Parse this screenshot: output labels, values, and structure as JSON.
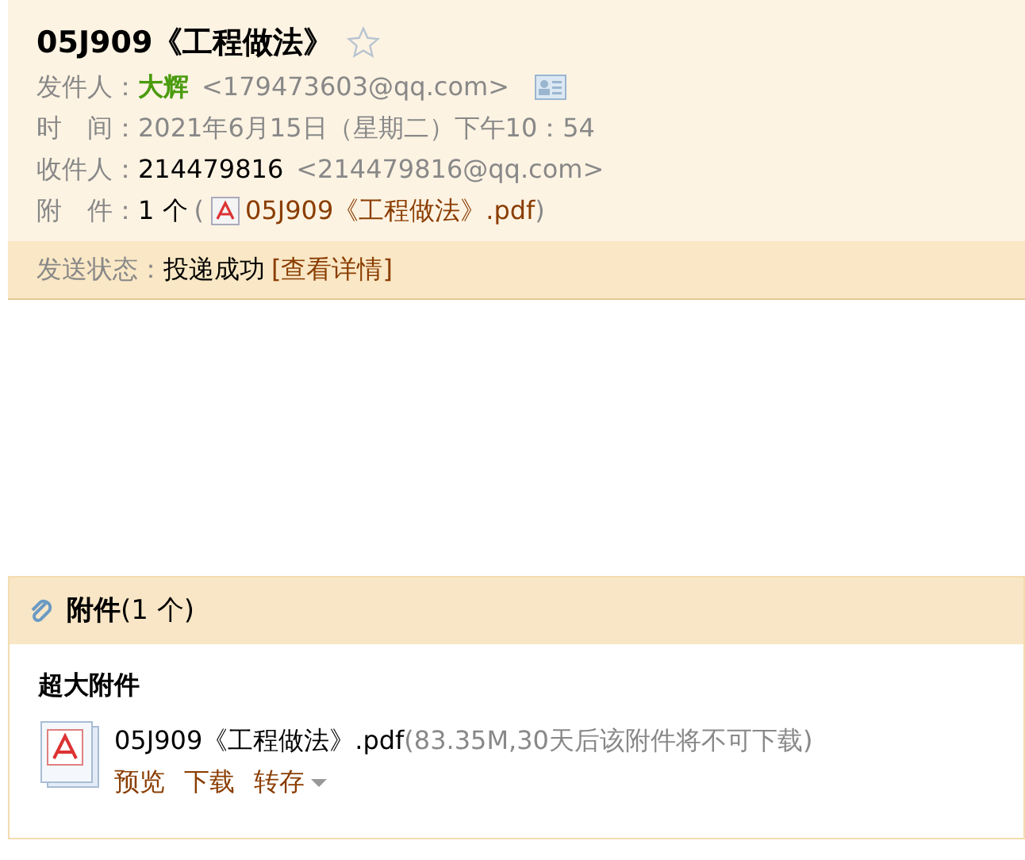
{
  "header": {
    "subject": "05J909《工程做法》",
    "starred": false,
    "from": {
      "label": "发件人：",
      "name": "大辉",
      "email": "<179473603@qq.com>"
    },
    "time": {
      "label": "时　间：",
      "value": "2021年6月15日（星期二）下午10：54"
    },
    "to": {
      "label": "收件人：",
      "name": "214479816",
      "email": "<214479816@qq.com>"
    },
    "attachments": {
      "label": "附　件：",
      "count": "1 个",
      "open": "(",
      "file": "05J909《工程做法》.pdf",
      "close": ")"
    },
    "status": {
      "label": "发送状态：",
      "value": "投递成功",
      "link": "[查看详情]"
    }
  },
  "attachment_section": {
    "title": "附件",
    "count": "(1 个)",
    "group_title": "超大附件",
    "files": [
      {
        "name": "05J909《工程做法》.pdf",
        "info": "(83.35M,30天后该附件将不可下载)",
        "actions": [
          "预览",
          "下载",
          "转存"
        ]
      }
    ]
  }
}
